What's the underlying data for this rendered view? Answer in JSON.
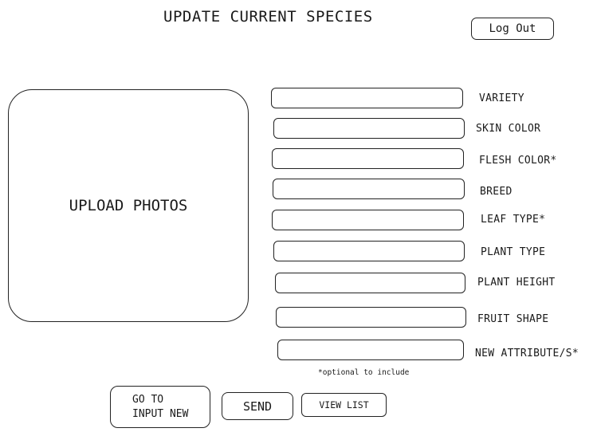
{
  "header": {
    "title": "UPDATE CURRENT SPECIES",
    "logout_label": "Log Out"
  },
  "upload": {
    "label": "UPLOAD PHOTOS"
  },
  "form": {
    "fields": [
      {
        "label": "VARIETY",
        "value": ""
      },
      {
        "label": "SKIN COLOR",
        "value": ""
      },
      {
        "label": "FLESH COLOR*",
        "value": ""
      },
      {
        "label": "BREED",
        "value": ""
      },
      {
        "label": "LEAF TYPE*",
        "value": ""
      },
      {
        "label": "PLANT TYPE",
        "value": ""
      },
      {
        "label": "PLANT HEIGHT",
        "value": ""
      },
      {
        "label": "FRUIT SHAPE",
        "value": ""
      },
      {
        "label": "NEW ATTRIBUTE/S*",
        "value": ""
      }
    ],
    "note": "*optional to include"
  },
  "actions": {
    "goto_line1": "GO TO",
    "goto_line2": "INPUT NEW",
    "send_label": "SEND",
    "viewlist_label": "VIEW LIST"
  }
}
